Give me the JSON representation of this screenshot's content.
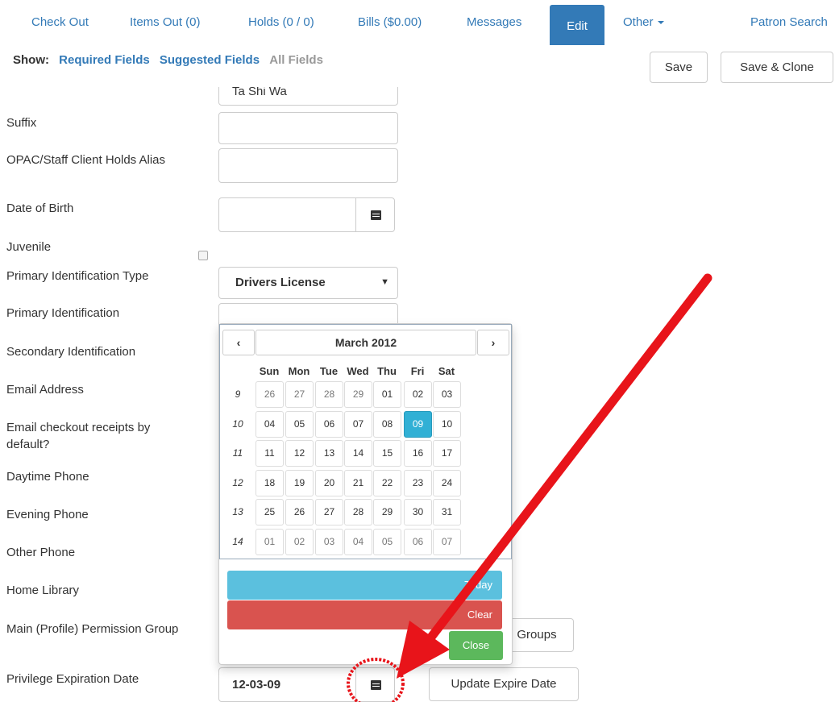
{
  "nav": {
    "check_out": "Check Out",
    "items_out": "Items Out (0)",
    "holds": "Holds (0 / 0)",
    "bills": "Bills ($0.00)",
    "messages": "Messages",
    "edit": "Edit",
    "other": "Other",
    "patron_search": "Patron Search"
  },
  "show": {
    "label": "Show:",
    "required": "Required Fields",
    "suggested": "Suggested Fields",
    "all": "All Fields"
  },
  "actions": {
    "save": "Save",
    "save_clone": "Save & Clone"
  },
  "fields": {
    "top_value": "Ta Shi Wa",
    "suffix": "Suffix",
    "holds_alias": "OPAC/Staff Client Holds Alias",
    "dob": "Date of Birth",
    "juvenile": "Juvenile",
    "primary_id_type": "Primary Identification Type",
    "primary_id_type_value": "Drivers License",
    "primary_id": "Primary Identification",
    "secondary_id": "Secondary Identification",
    "email": "Email Address",
    "email_receipts": "Email checkout receipts by default?",
    "day_phone": "Daytime Phone",
    "eve_phone": "Evening Phone",
    "other_phone": "Other Phone",
    "home_library": "Home Library",
    "perm_group": "Main (Profile) Permission Group",
    "groups_button": "Groups",
    "expire_label": "Privilege Expiration Date",
    "expire_value": "12-03-09",
    "update_expire": "Update Expire Date"
  },
  "datepicker": {
    "month": "March 2012",
    "prev": "<",
    "next": ">",
    "dow": [
      "Sun",
      "Mon",
      "Tue",
      "Wed",
      "Thu",
      "Fri",
      "Sat"
    ],
    "weeks": [
      {
        "wk": "9",
        "days": [
          "26",
          "27",
          "28",
          "29",
          "01",
          "02",
          "03"
        ]
      },
      {
        "wk": "10",
        "days": [
          "04",
          "05",
          "06",
          "07",
          "08",
          "09",
          "10"
        ]
      },
      {
        "wk": "11",
        "days": [
          "11",
          "12",
          "13",
          "14",
          "15",
          "16",
          "17"
        ]
      },
      {
        "wk": "12",
        "days": [
          "18",
          "19",
          "20",
          "21",
          "22",
          "23",
          "24"
        ]
      },
      {
        "wk": "13",
        "days": [
          "25",
          "26",
          "27",
          "28",
          "29",
          "30",
          "31"
        ]
      },
      {
        "wk": "14",
        "days": [
          "01",
          "02",
          "03",
          "04",
          "05",
          "06",
          "07"
        ]
      }
    ],
    "selected": "09",
    "today": "Today",
    "clear": "Clear",
    "close": "Close"
  },
  "colors": {
    "primary": "#337ab7",
    "info": "#5bc0de",
    "danger": "#d9534f",
    "success": "#5cb85c",
    "annotation": "#e8141a"
  }
}
